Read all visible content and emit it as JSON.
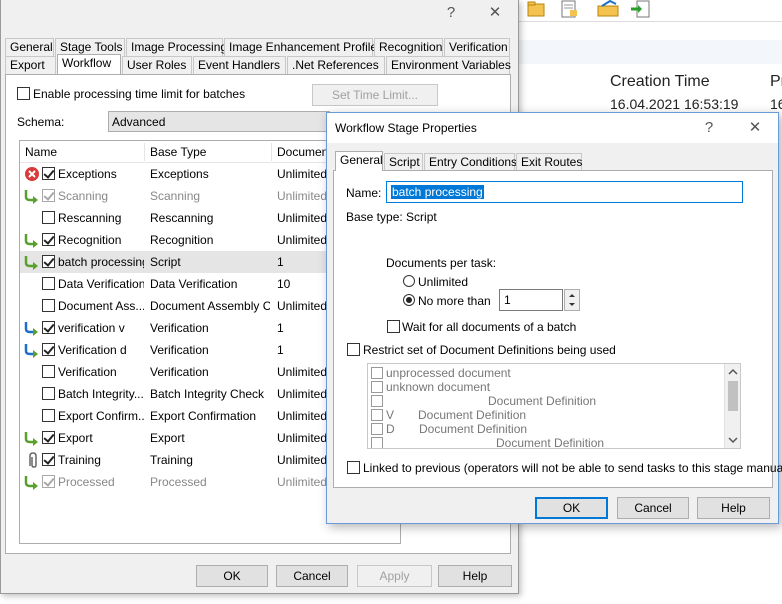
{
  "background_window": {
    "columns": {
      "creation_time": "Creation Time",
      "pr": "Pr"
    },
    "cell_time": "16.04.2021 16:53:19",
    "cell_16": "16"
  },
  "main_dialog": {
    "title_help": "?",
    "title_close": "✕",
    "tabs_row1": [
      "General",
      "Stage Tools",
      "Image Processing",
      "Image Enhancement Profiles",
      "Recognition",
      "Verification"
    ],
    "tabs_row2": [
      "Export",
      "Workflow",
      "User Roles",
      "Event Handlers",
      ".Net References",
      "Environment Variables"
    ],
    "active_tab": "Workflow",
    "enable_time_limit_label": "Enable processing time limit for batches",
    "set_time_limit_label": "Set Time Limit...",
    "schema_label": "Schema:",
    "schema_value": "Advanced",
    "grid_headers": {
      "name": "Name",
      "base_type": "Base Type",
      "documents": "Documents"
    },
    "stages": [
      {
        "name": "Exceptions",
        "type": "Exceptions",
        "docs": "Unlimited",
        "checked": true,
        "indicator": "error",
        "grey": false
      },
      {
        "name": "Scanning",
        "type": "Scanning",
        "docs": "Unlimited",
        "checked": true,
        "indicator": "arrow",
        "grey": true
      },
      {
        "name": "Rescanning",
        "type": "Rescanning",
        "docs": "Unlimited",
        "checked": false,
        "indicator": "",
        "grey": false
      },
      {
        "name": "Recognition",
        "type": "Recognition",
        "docs": "Unlimited",
        "checked": true,
        "indicator": "arrow",
        "grey": false
      },
      {
        "name": "batch processing",
        "type": "Script",
        "docs": "1",
        "checked": true,
        "indicator": "arrow",
        "grey": false,
        "selected": true
      },
      {
        "name": "Data Verification",
        "type": "Data Verification",
        "docs": "10",
        "checked": false,
        "indicator": "",
        "grey": false
      },
      {
        "name": "Document Ass...",
        "type": "Document Assembly C...",
        "docs": "Unlimited",
        "checked": false,
        "indicator": "",
        "grey": false
      },
      {
        "name": "verification v",
        "type": "Verification",
        "docs": "1",
        "checked": true,
        "indicator": "arrow-blue",
        "grey": false
      },
      {
        "name": "Verification d",
        "type": "Verification",
        "docs": "1",
        "checked": true,
        "indicator": "arrow-blue",
        "grey": false
      },
      {
        "name": "Verification",
        "type": "Verification",
        "docs": "Unlimited",
        "checked": false,
        "indicator": "",
        "grey": false
      },
      {
        "name": "Batch Integrity...",
        "type": "Batch Integrity Check",
        "docs": "Unlimited",
        "checked": false,
        "indicator": "",
        "grey": false
      },
      {
        "name": "Export Confirm...",
        "type": "Export Confirmation",
        "docs": "Unlimited",
        "checked": false,
        "indicator": "",
        "grey": false
      },
      {
        "name": "Export",
        "type": "Export",
        "docs": "Unlimited",
        "checked": true,
        "indicator": "arrow",
        "grey": false
      },
      {
        "name": "Training",
        "type": "Training",
        "docs": "Unlimited",
        "checked": true,
        "indicator": "clip",
        "grey": false
      },
      {
        "name": "Processed",
        "type": "Processed",
        "docs": "Unlimited",
        "checked": true,
        "indicator": "arrow",
        "grey": true
      }
    ],
    "buttons": {
      "ok": "OK",
      "cancel": "Cancel",
      "apply": "Apply",
      "help": "Help"
    }
  },
  "stage_dialog": {
    "title": "Workflow Stage Properties",
    "title_help": "?",
    "title_close": "✕",
    "tabs": [
      "General",
      "Script",
      "Entry Conditions",
      "Exit Routes"
    ],
    "active_tab": "General",
    "name_label": "Name:",
    "name_value": "batch processing",
    "base_type_text": "Base type: Script",
    "docs_per_task_label": "Documents per task:",
    "radio_unlimited": "Unlimited",
    "radio_no_more_than": "No more than",
    "no_more_than_value": "1",
    "wait_all_label": "Wait for all documents of a batch",
    "restrict_label": "Restrict set of Document Definitions being used",
    "definitions": [
      {
        "left": "unprocessed document",
        "right": ""
      },
      {
        "left": "unknown document",
        "right": ""
      },
      {
        "left": "",
        "right": "Document Definition"
      },
      {
        "left": "V",
        "right": "Document Definition"
      },
      {
        "left": "D",
        "right": "Document Definition"
      },
      {
        "left": "",
        "right": "Document Definition"
      }
    ],
    "linked_label": "Linked to previous (operators will not be able to send tasks to this stage manually)",
    "buttons": {
      "ok": "OK",
      "cancel": "Cancel",
      "help": "Help"
    }
  }
}
